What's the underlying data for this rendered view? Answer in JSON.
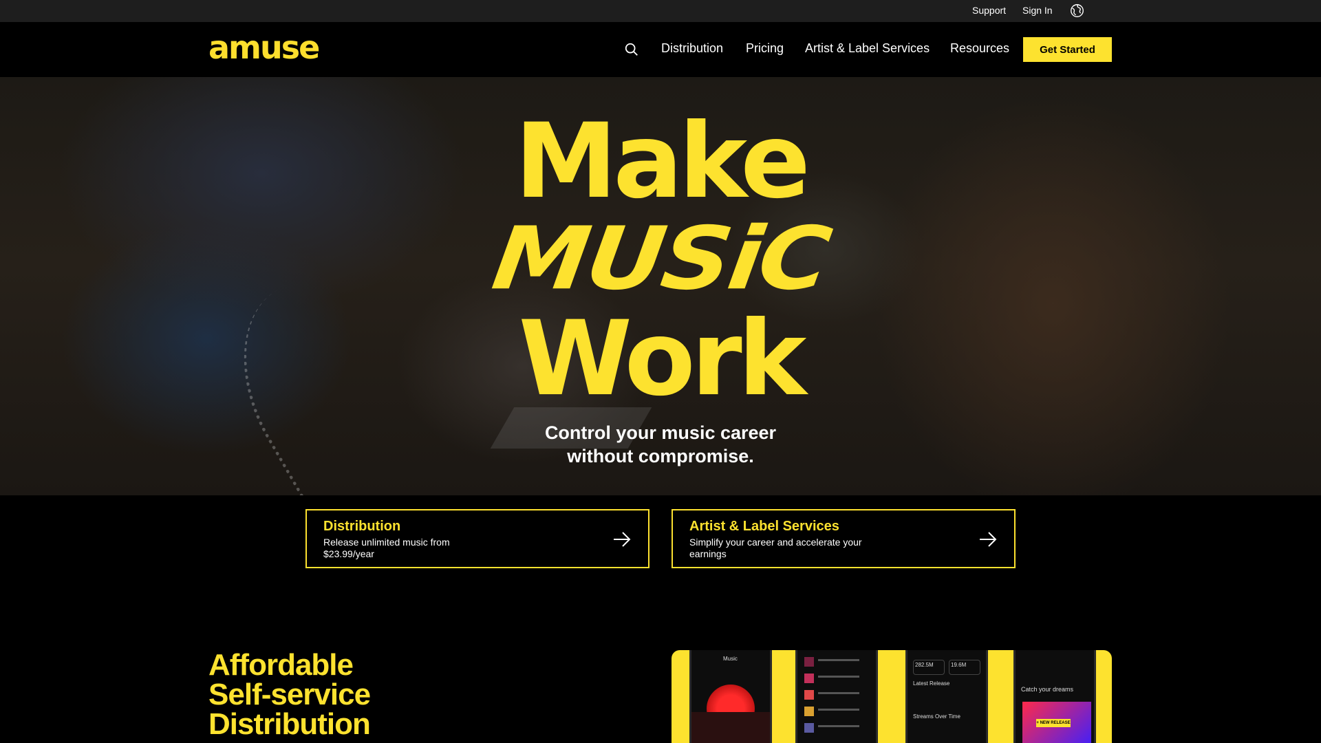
{
  "utility": {
    "support": "Support",
    "sign_in": "Sign In",
    "language_icon": "globe-icon"
  },
  "header": {
    "logo": "amuse",
    "search_icon": "search-icon",
    "nav": [
      "Distribution",
      "Pricing",
      "Artist & Label Services",
      "Resources"
    ],
    "cta": "Get Started"
  },
  "hero": {
    "title_line1": "Make",
    "title_line2": "MUSiC",
    "title_line3": "Work",
    "subtitle_line1": "Control your music career",
    "subtitle_line2": "without compromise."
  },
  "cards": [
    {
      "title": "Distribution",
      "desc": "Release unlimited music from $23.99/year",
      "icon": "arrow-right-icon"
    },
    {
      "title": "Artist & Label Services",
      "desc": "Simplify your career and accelerate your earnings",
      "icon": "arrow-right-icon"
    }
  ],
  "section": {
    "title_line1": "Affordable",
    "title_line2": "Self-service",
    "title_line3": "Distribution"
  },
  "app_screens": {
    "stat1": "282.5M",
    "stat2": "19.6M",
    "latest_release": "Latest Release",
    "streams_over_time": "Streams Over Time",
    "catch_dreams": "Catch your dreams",
    "new_release": "+ NEW RELEASE",
    "music_tab": "Music"
  },
  "colors": {
    "accent": "#fde22f",
    "background": "#000000",
    "utility_bar": "#1e1e1e"
  }
}
